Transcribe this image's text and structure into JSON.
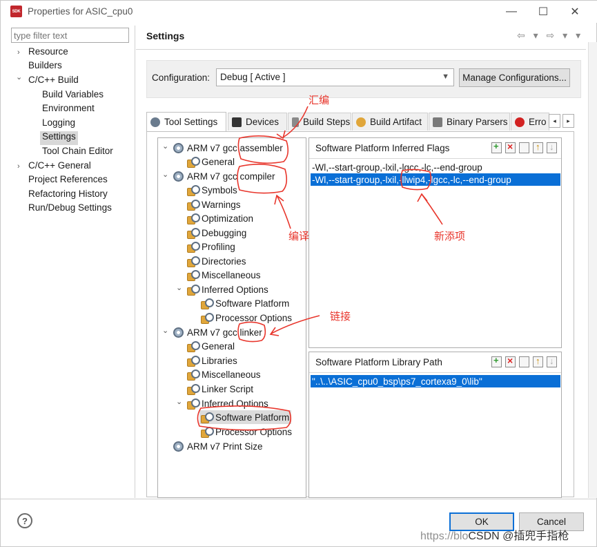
{
  "window": {
    "title": "Properties for ASIC_cpu0",
    "app_icon_text": "SDK",
    "minimize": "—",
    "maximize": "☐",
    "close": "✕"
  },
  "filter": {
    "placeholder": "type filter text"
  },
  "left_tree": [
    {
      "label": "Resource",
      "arrow": "›"
    },
    {
      "label": "Builders"
    },
    {
      "label": "C/C++ Build",
      "arrow": "⌄"
    },
    {
      "label": "Build Variables"
    },
    {
      "label": "Environment"
    },
    {
      "label": "Logging"
    },
    {
      "label": "Settings"
    },
    {
      "label": "Tool Chain Editor"
    },
    {
      "label": "C/C++ General",
      "arrow": "›"
    },
    {
      "label": "Project References"
    },
    {
      "label": "Refactoring History"
    },
    {
      "label": "Run/Debug Settings"
    }
  ],
  "header": {
    "title": "Settings",
    "nav": "⇦ ▾ ⇨ ▾ ▾"
  },
  "configuration": {
    "label": "Configuration:",
    "value": "Debug  [ Active ]",
    "manage_label": "Manage Configurations..."
  },
  "tabs": [
    {
      "label": "Tool Settings",
      "icon_color": "#6a7b8e"
    },
    {
      "label": "Devices",
      "icon_color": "#333333"
    },
    {
      "label": "Build Steps",
      "icon_color": "#8a8a8a"
    },
    {
      "label": "Build Artifact",
      "icon_color": "#e0a63a"
    },
    {
      "label": "Binary Parsers",
      "icon_color": "#7a7a7a"
    },
    {
      "label": "Erro",
      "icon_color": "#d22222"
    }
  ],
  "tab_scroll": {
    "left": "◂",
    "right": "▸"
  },
  "tool_tree": [
    {
      "label": "ARM v7 gcc assembler"
    },
    {
      "label": "General"
    },
    {
      "label": "ARM v7 gcc compiler"
    },
    {
      "label": "Symbols"
    },
    {
      "label": "Warnings"
    },
    {
      "label": "Optimization"
    },
    {
      "label": "Debugging"
    },
    {
      "label": "Profiling"
    },
    {
      "label": "Directories"
    },
    {
      "label": "Miscellaneous"
    },
    {
      "label": "Inferred Options"
    },
    {
      "label": "Software Platform"
    },
    {
      "label": "Processor Options"
    },
    {
      "label": "ARM v7 gcc linker"
    },
    {
      "label": "General"
    },
    {
      "label": "Libraries"
    },
    {
      "label": "Miscellaneous"
    },
    {
      "label": "Linker Script"
    },
    {
      "label": "Inferred Options"
    },
    {
      "label": "Software Platform"
    },
    {
      "label": "Processor Options"
    },
    {
      "label": "ARM v7 Print Size"
    }
  ],
  "inferred_flags": {
    "title": "Software Platform Inferred Flags",
    "rows": [
      "-Wl,--start-group,-lxil,-lgcc,-lc,--end-group",
      "-Wl,--start-group,-lxil,-llwip4,-lgcc,-lc,--end-group"
    ]
  },
  "library_path": {
    "title": "Software Platform Library Path",
    "rows": [
      "\"..\\..\\ASIC_cpu0_bsp\\ps7_cortexa9_0\\lib\""
    ]
  },
  "footer": {
    "help": "?",
    "ok_label": "OK",
    "cancel_label": "Cancel"
  },
  "watermark": {
    "prefix": "https://blo",
    "text": "CSDN @插兜手指枪"
  },
  "annotations": {
    "assembler": "汇编",
    "compiler": "编译",
    "new_item": "新添项",
    "linker": "链接"
  },
  "colors": {
    "selection": "#0a6fd6",
    "annotation": "#e8352b",
    "tree_selection": "#dcdcdc"
  }
}
